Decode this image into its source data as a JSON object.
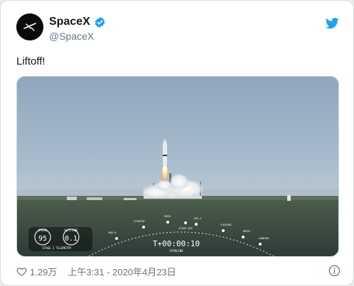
{
  "user": {
    "display_name": "SpaceX",
    "handle": "@SpaceX",
    "verified": true
  },
  "tweet": {
    "text": "Liftoff!"
  },
  "video": {
    "timer": "T+00:00:10",
    "timer_sub": "STARLINK",
    "telemetry_label": "STAGE 2 TELEMETRY",
    "speed_label": "SPEED",
    "speed_value": "95",
    "altitude_label": "ALTITUDE",
    "altitude_value": "0.1",
    "events": [
      "MAX-Q",
      "STARTUP",
      "MECO",
      "STAGE SEP",
      "SES-1",
      "FAIRING",
      "ENTRY",
      "LANDING"
    ]
  },
  "footer": {
    "likes": "1.29万",
    "timestamp": "上午3:31 - 2020年4月23日"
  },
  "colors": {
    "brand_blue": "#1da1f2",
    "text_secondary": "#657786"
  },
  "icons": [
    "spacex-logo-icon",
    "verified-badge-icon",
    "twitter-bird-icon",
    "heart-icon",
    "info-icon"
  ]
}
